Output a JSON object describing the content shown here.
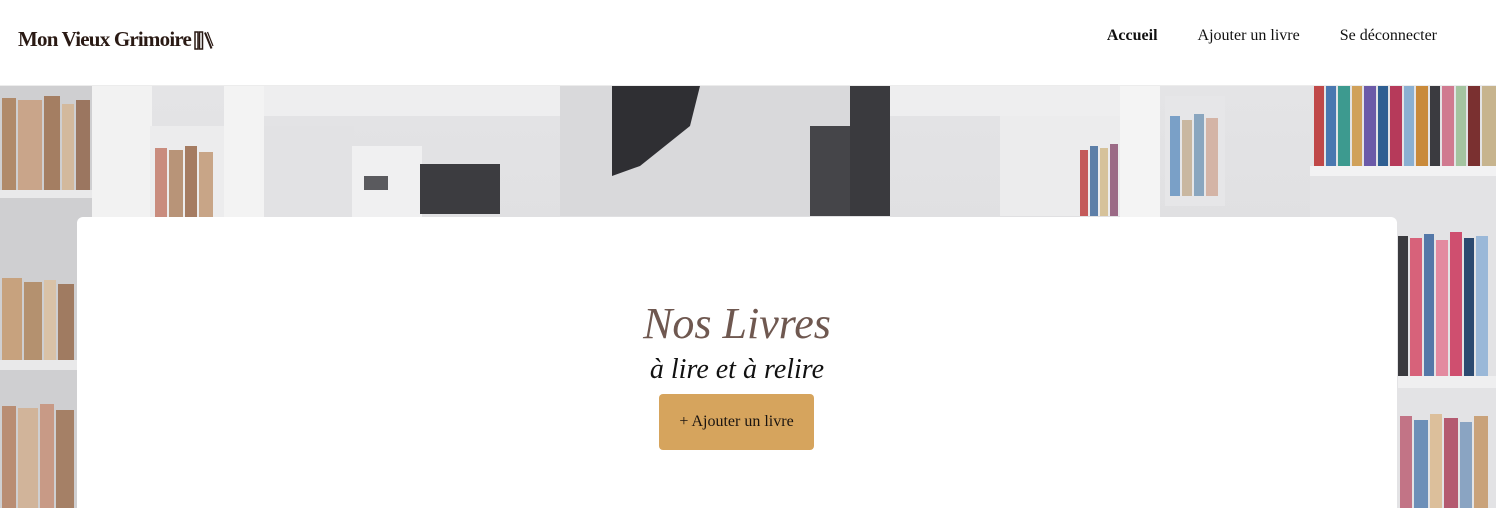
{
  "header": {
    "logo_text": "Mon Vieux Grimoire",
    "logo_icon": "books-icon",
    "nav": [
      {
        "label": "Accueil",
        "active": true
      },
      {
        "label": "Ajouter un livre",
        "active": false
      },
      {
        "label": "Se déconnecter",
        "active": false
      }
    ]
  },
  "hero": {
    "background": "library-bookshelves-photo"
  },
  "main": {
    "title": "Nos Livres",
    "subtitle": "à lire et à relire",
    "add_button_label": "+ Ajouter un livre"
  },
  "colors": {
    "accent": "#d6a45d",
    "title": "#6f5850",
    "logo": "#2a1a14"
  }
}
